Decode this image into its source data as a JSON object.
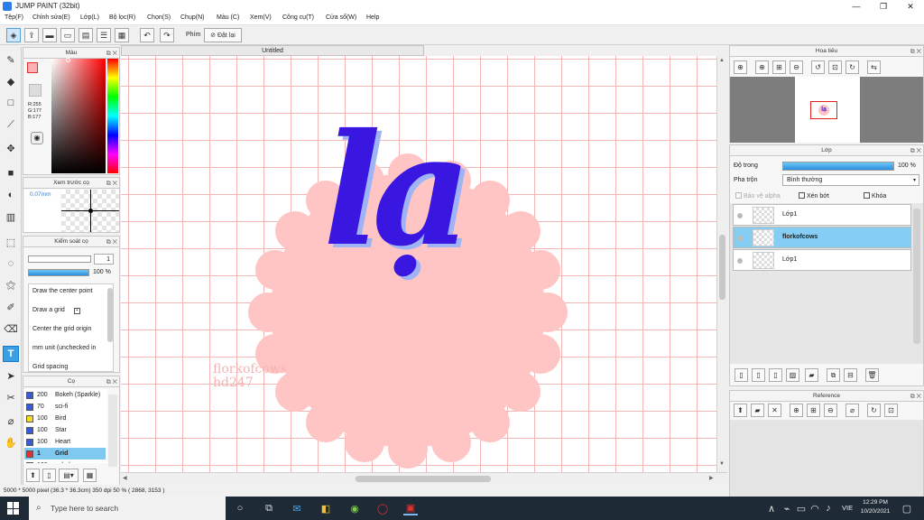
{
  "window": {
    "title": "JUMP PAINT (32bit)",
    "minimize": "—",
    "maximize": "❐",
    "close": "✕"
  },
  "menu": [
    "Tệp(F)",
    "Chỉnh sửa(E)",
    "Lớp(L)",
    "Bộ lọc(R)",
    "Chọn(S)",
    "Chụp(N)",
    "Màu (C)",
    "Xem(V)",
    "Công cụ(T)",
    "Cửa sổ(W)",
    "Help"
  ],
  "toolbar": {
    "phim_label": "Phím",
    "reset_label": "Đặt lại"
  },
  "color_panel": {
    "title": "Màu",
    "r": "R:255",
    "g": "G:177",
    "b": "B:177",
    "fg_color": "#ffb1b1"
  },
  "preview_panel": {
    "title": "Xem trước cọ",
    "size": "0.07mm"
  },
  "control_panel": {
    "title": "Kiểm soát cọ",
    "size_value": "1",
    "opacity_value": "100 %",
    "options": [
      "Draw the center point",
      "Draw a grid",
      "Center the grid origin",
      "mm unit (unchecked in",
      "Grid spacing"
    ]
  },
  "brush_panel": {
    "title": "Cọ",
    "items": [
      {
        "size": "200",
        "name": "Bokeh (Sparkle)",
        "color": "#3a5bd8",
        "selected": false
      },
      {
        "size": "70",
        "name": "sci-fi",
        "color": "#3a5bd8",
        "selected": false
      },
      {
        "size": "100",
        "name": "Bird",
        "color": "#f0e020",
        "selected": false
      },
      {
        "size": "100",
        "name": "Star",
        "color": "#3a5bd8",
        "selected": false
      },
      {
        "size": "100",
        "name": "Heart",
        "color": "#3a5bd8",
        "selected": false
      },
      {
        "size": "1",
        "name": "Grid",
        "color": "#e03030",
        "selected": true
      },
      {
        "size": "100",
        "name": "sobeh",
        "color": "#3a5bd8",
        "selected": false
      }
    ]
  },
  "document": {
    "tab_title": "Untitled",
    "artwork_text": "lạ",
    "watermark_line1": "florkofcows",
    "watermark_line2": "hd247"
  },
  "status": {
    "text": "5000 * 5000 pixel  (36.3 * 36.3cm)  350 dpi  50 %  ( 2868, 3153 )"
  },
  "navigator": {
    "title": "Hoa tiêu"
  },
  "layer_panel": {
    "title": "Lớp",
    "opacity_label": "Độ trong",
    "opacity_value": "100 %",
    "blend_label": "Pha trộn",
    "blend_value": "Bình thường",
    "protect_alpha": "Bảo vệ alpha",
    "clipping": "Xén bớt",
    "lock": "Khóa",
    "layers": [
      {
        "name": "Lớp1",
        "selected": false
      },
      {
        "name": "florkofcows",
        "selected": true
      },
      {
        "name": "Lớp1",
        "selected": false
      }
    ]
  },
  "reference_panel": {
    "title": "Reference"
  },
  "taskbar": {
    "search_placeholder": "Type here to search",
    "lang": "VIE",
    "time": "12:29 PM",
    "date": "10/20/2021"
  }
}
